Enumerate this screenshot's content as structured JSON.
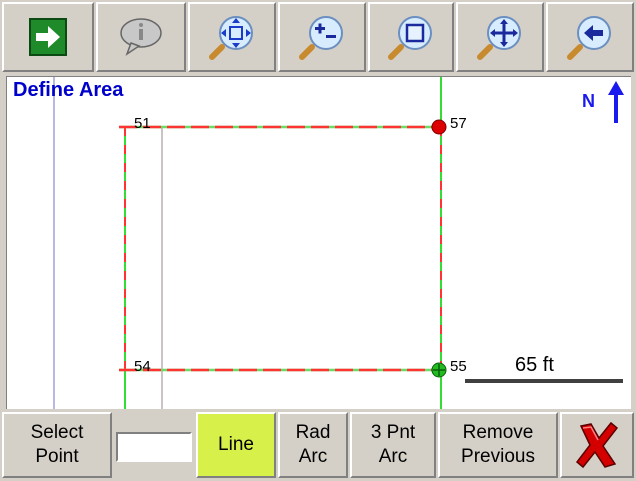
{
  "toolbar": {
    "buttons": [
      {
        "name": "go-button",
        "icon": "right-arrow-icon"
      },
      {
        "name": "info-button",
        "icon": "info-bubble-icon"
      },
      {
        "name": "zoom-extents-button",
        "icon": "zoom-extents-icon"
      },
      {
        "name": "zoom-in-out-button",
        "icon": "zoom-in-out-icon"
      },
      {
        "name": "zoom-window-button",
        "icon": "zoom-window-icon"
      },
      {
        "name": "pan-button",
        "icon": "pan-icon"
      },
      {
        "name": "zoom-previous-button",
        "icon": "zoom-previous-icon"
      }
    ]
  },
  "map": {
    "title": "Define Area",
    "north_label": "N",
    "scale_label": "65 ft",
    "points": [
      {
        "id": "51",
        "status": "none"
      },
      {
        "id": "57",
        "status": "selected",
        "color": "#dd0000"
      },
      {
        "id": "54",
        "status": "none"
      },
      {
        "id": "55",
        "status": "current",
        "color": "#22bb22"
      }
    ],
    "colors": {
      "boundary_dash_a": "#ff3333",
      "boundary_dash_b": "#66dd66",
      "vertical_line": "#33dd33",
      "grid_line": "#a0a0d8"
    }
  },
  "bottom": {
    "select_point": "Select\nPoint",
    "input_value": "",
    "line": "Line",
    "rad_arc": "Rad\nArc",
    "three_pnt_arc": "3 Pnt\nArc",
    "remove_previous": "Remove\nPrevious",
    "cancel_icon": "red-x-icon",
    "active_color": "#d8f04a"
  }
}
